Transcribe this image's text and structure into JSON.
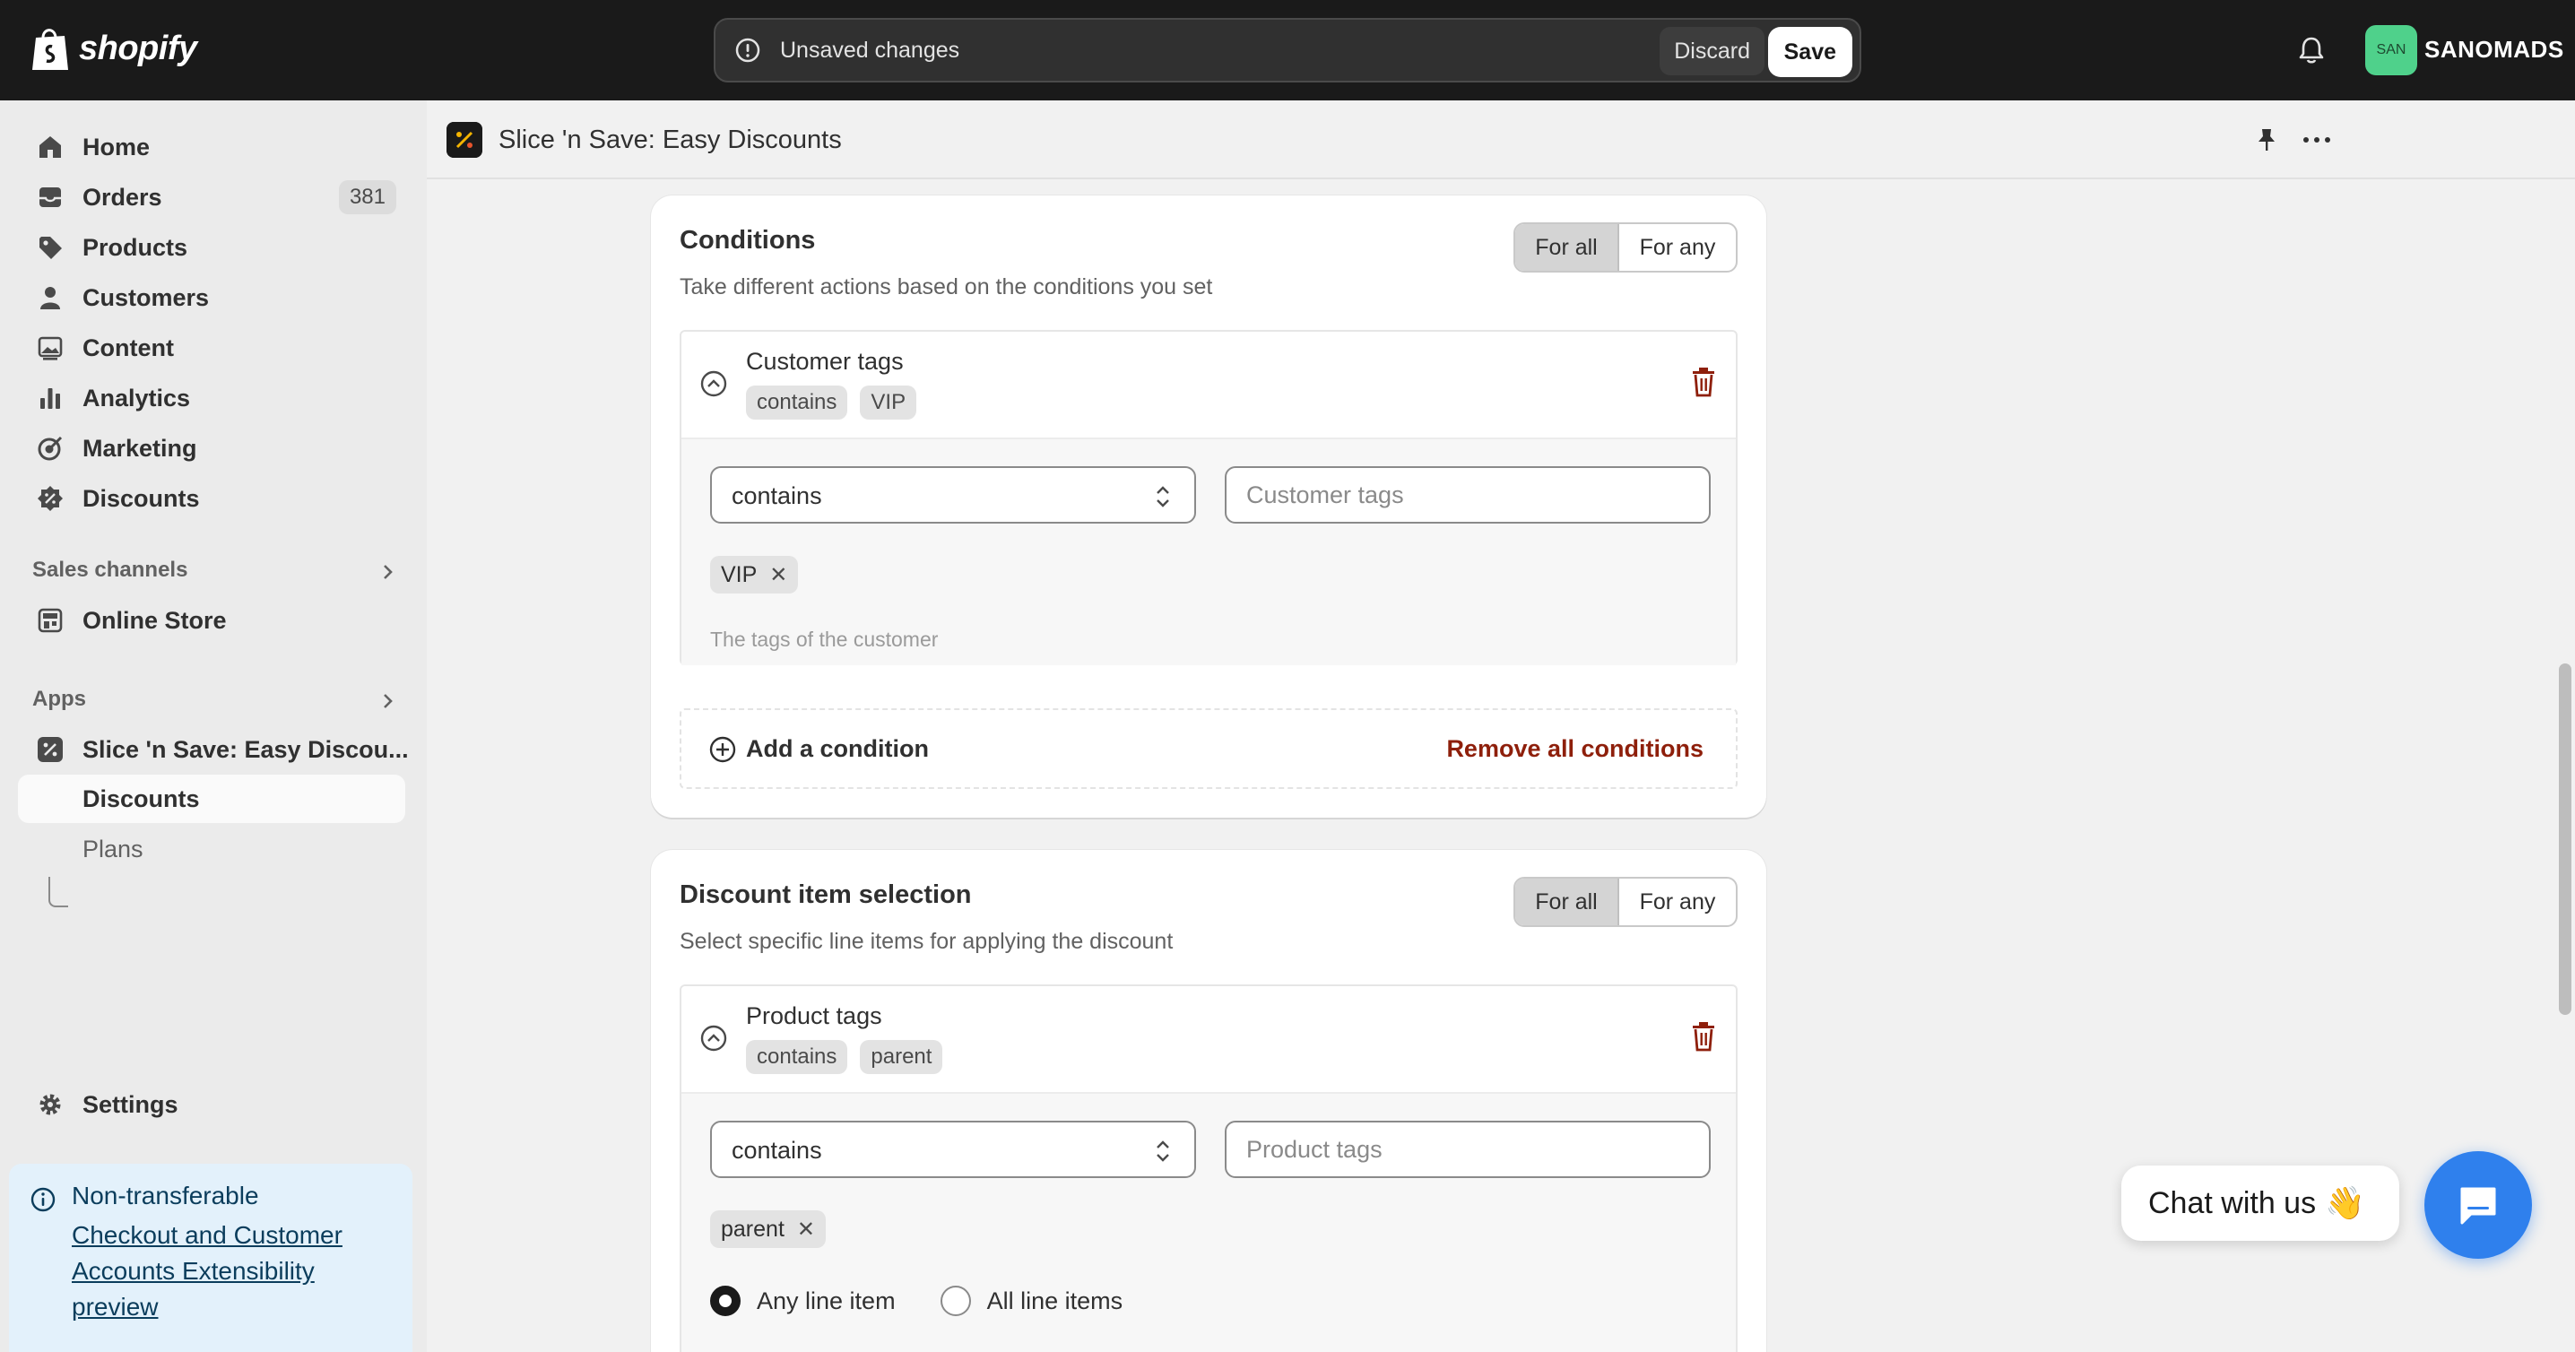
{
  "topbar": {
    "brand": "shopify",
    "unsaved_text": "Unsaved changes",
    "discard_label": "Discard",
    "save_label": "Save",
    "avatar_initials": "SAN",
    "store_name": "SANOMADS"
  },
  "sidebar": {
    "items": [
      {
        "label": "Home",
        "icon": "home-icon"
      },
      {
        "label": "Orders",
        "icon": "orders-icon",
        "count": "381"
      },
      {
        "label": "Products",
        "icon": "tag-icon"
      },
      {
        "label": "Customers",
        "icon": "person-icon"
      },
      {
        "label": "Content",
        "icon": "image-icon"
      },
      {
        "label": "Analytics",
        "icon": "bar-chart-icon"
      },
      {
        "label": "Marketing",
        "icon": "target-icon"
      },
      {
        "label": "Discounts",
        "icon": "discount-icon"
      }
    ],
    "sales_channels_label": "Sales channels",
    "online_store_label": "Online Store",
    "apps_label": "Apps",
    "app_item_label": "Slice 'n Save: Easy Discou...",
    "app_sub_discounts": "Discounts",
    "app_sub_plans": "Plans",
    "settings_label": "Settings",
    "banner_title": "Non-transferable",
    "banner_link": "Checkout and Customer Accounts Extensibility preview"
  },
  "app_header": {
    "title": "Slice 'n Save: Easy Discounts"
  },
  "conditions_card": {
    "title": "Conditions",
    "subtitle": "Take different actions based on the conditions you set",
    "seg_all": "For all",
    "seg_any": "For any",
    "condition": {
      "name": "Customer tags",
      "chip_operator": "contains",
      "chip_value": "VIP",
      "select_value": "contains",
      "input_placeholder": "Customer tags",
      "tag": "VIP",
      "help": "The tags of the customer"
    },
    "add_label": "Add a condition",
    "remove_label": "Remove all conditions"
  },
  "selection_card": {
    "title": "Discount item selection",
    "subtitle": "Select specific line items for applying the discount",
    "seg_all": "For all",
    "seg_any": "For any",
    "condition": {
      "name": "Product tags",
      "chip_operator": "contains",
      "chip_value": "parent",
      "select_value": "contains",
      "input_placeholder": "Product tags",
      "tag": "parent",
      "radio_any": "Any line item",
      "radio_all": "All line items",
      "radio_selected": "Any line item"
    }
  },
  "chat": {
    "label": "Chat with us",
    "emoji": "👋"
  },
  "colors": {
    "topbar": "#1a1a1a",
    "critical": "#8e1f0b",
    "chat_button": "#2f80ed",
    "avatar": "#4fd18b"
  }
}
